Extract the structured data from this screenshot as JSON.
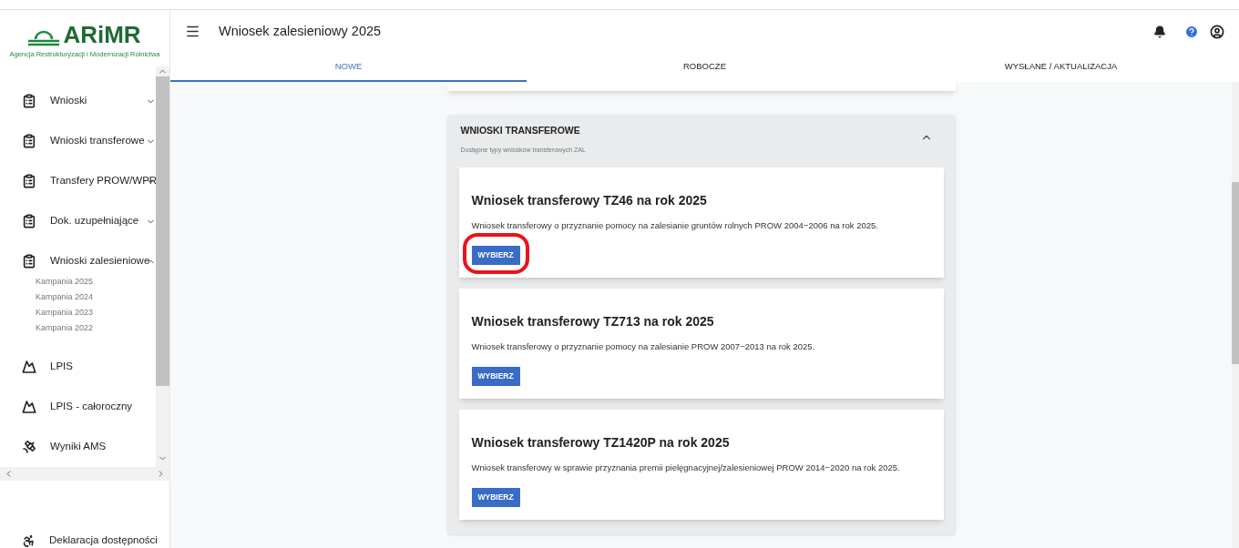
{
  "logo": {
    "name": "ARiMR",
    "tagline": "Agencja Restrukturyzacji i Modernizacji Rolnictwa"
  },
  "sidebar": {
    "items": [
      {
        "label": "Wnioski",
        "kind": "document",
        "expanded": false
      },
      {
        "label": "Wnioski transferowe",
        "kind": "document",
        "expanded": false
      },
      {
        "label": "Transfery PROW/WPR",
        "kind": "document",
        "expanded": false
      },
      {
        "label": "Dok. uzupełniające",
        "kind": "document",
        "expanded": false
      },
      {
        "label": "Wnioski zalesieniowe",
        "kind": "document",
        "expanded": true,
        "children": [
          {
            "label": "Kampania 2025"
          },
          {
            "label": "Kampania 2024"
          },
          {
            "label": "Kampania 2023"
          },
          {
            "label": "Kampania 2022"
          }
        ]
      },
      {
        "label": "LPIS",
        "kind": "terrain"
      },
      {
        "label": "LPIS - całoroczny",
        "kind": "terrain"
      },
      {
        "label": "Wyniki AMS",
        "kind": "satellite"
      }
    ],
    "footer": {
      "label": "Deklaracja dostępności"
    }
  },
  "header": {
    "title": "Wniosek zalesieniowy 2025"
  },
  "tabs": [
    {
      "label": "NOWE",
      "selected": true
    },
    {
      "label": "ROBOCZE",
      "selected": false
    },
    {
      "label": "WYSŁANE / AKTUALIZACJA",
      "selected": false
    }
  ],
  "section": {
    "title": "WNIOSKI TRANSFEROWE",
    "subtitle": "Dostępne typy wniosków transferowych ZAL",
    "expanded": true,
    "cards": [
      {
        "title": "Wniosek transferowy TZ46 na rok 2025",
        "description": "Wniosek transferowy o przyznanie pomocy na zalesianie gruntów rolnych PROW 2004−2006 na rok 2025.",
        "button": "WYBIERZ",
        "highlighted": true
      },
      {
        "title": "Wniosek transferowy TZ713 na rok 2025",
        "description": "Wniosek transferowy o przyznanie pomocy na zalesianie PROW 2007−2013 na rok 2025.",
        "button": "WYBIERZ",
        "highlighted": false
      },
      {
        "title": "Wniosek transferowy TZ1420P na rok 2025",
        "description": "Wniosek transferowy w sprawie przyznania premii pielęgnacyjnej/zalesieniowej PROW 2014−2020 na rok 2025.",
        "button": "WYBIERZ",
        "highlighted": false
      }
    ]
  }
}
